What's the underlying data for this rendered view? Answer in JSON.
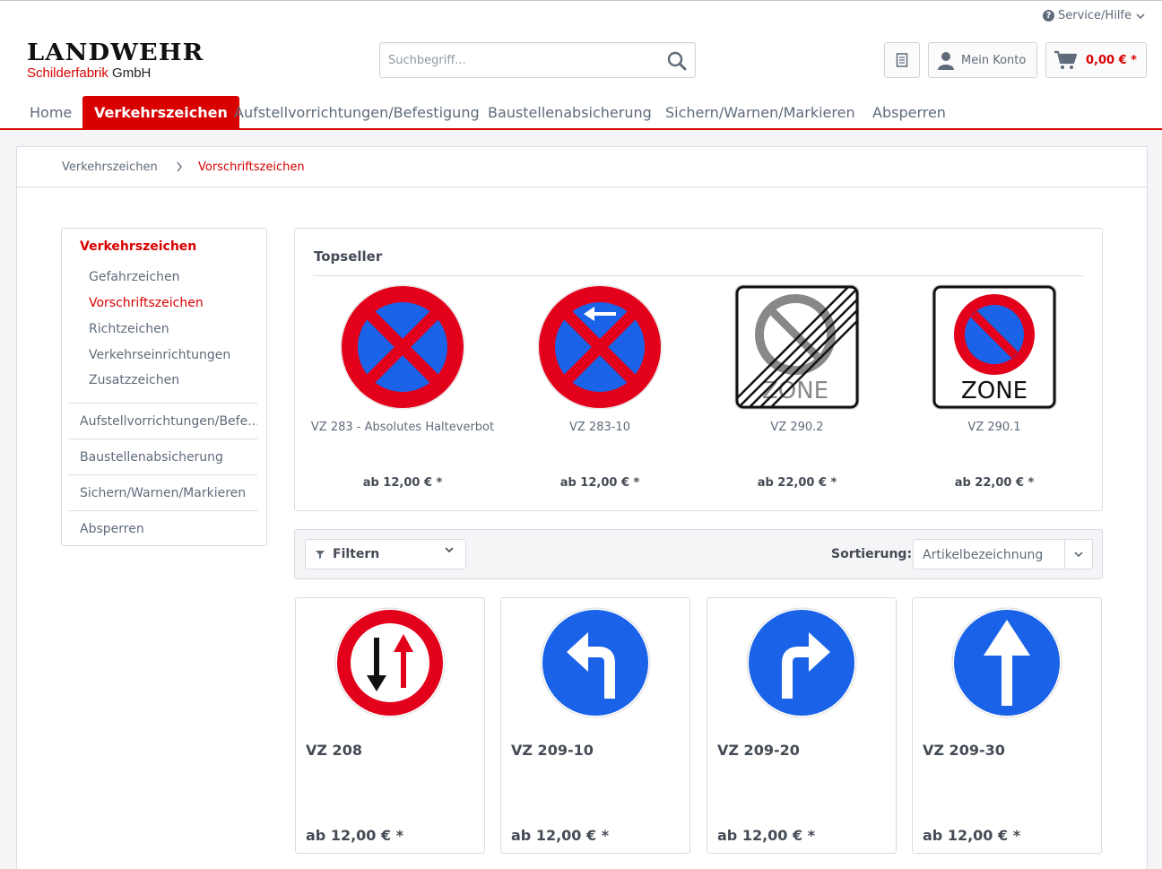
{
  "header": {
    "service_label": "Service/Hilfe",
    "logo_line1": "LANDWEHR",
    "logo_line2_red": "Schilderfabrik",
    "logo_line2_black": "GmbH",
    "search_placeholder": "Suchbegriff...",
    "account_label": "Mein Konto",
    "cart_amount": "0,00 € *"
  },
  "nav": [
    {
      "label": "Home"
    },
    {
      "label": "Verkehrszeichen"
    },
    {
      "label": "Aufstellvorrichtungen/Befestigung"
    },
    {
      "label": "Baustellenabsicherung"
    },
    {
      "label": "Sichern/Warnen/Markieren"
    },
    {
      "label": "Absperren"
    }
  ],
  "breadcrumb": [
    "Verkehrszeichen",
    "Vorschriftszeichen"
  ],
  "sidebar": {
    "heading": "Verkehrszeichen",
    "sub": [
      "Gefahrzeichen",
      "Vorschriftszeichen",
      "Richtzeichen",
      "Verkehrseinrichtungen",
      "Zusatzzeichen"
    ],
    "main": [
      "Aufstellvorrichtungen/Befe...",
      "Baustellenabsicherung",
      "Sichern/Warnen/Markieren",
      "Absperren"
    ]
  },
  "topseller": {
    "title": "Topseller",
    "items": [
      {
        "name": "VZ 283 - Absolutes Halteverbot",
        "price": "ab 12,00 € *",
        "icon": "halteverbot-sign-icon"
      },
      {
        "name": "VZ 283-10",
        "price": "ab 12,00 € *",
        "icon": "halteverbot-arrow-sign-icon"
      },
      {
        "name": "VZ 290.2",
        "price": "ab 22,00 € *",
        "icon": "zone-end-sign-icon"
      },
      {
        "name": "VZ 290.1",
        "price": "ab 22,00 € *",
        "icon": "zone-parking-sign-icon"
      }
    ],
    "zone_text": "ZONE"
  },
  "filterbar": {
    "filter_label": "Filtern",
    "sort_label": "Sortierung:",
    "sort_value": "Artikelbezeichnung"
  },
  "products": [
    {
      "name": "VZ 208",
      "price": "ab 12,00 € *",
      "icon": "vorrang-gegenverkehr-sign-icon"
    },
    {
      "name": "VZ 209-10",
      "price": "ab 12,00 € *",
      "icon": "links-abbiegen-sign-icon"
    },
    {
      "name": "VZ 209-20",
      "price": "ab 12,00 € *",
      "icon": "rechts-abbiegen-sign-icon"
    },
    {
      "name": "VZ 209-30",
      "price": "ab 12,00 € *",
      "icon": "geradeaus-sign-icon"
    }
  ],
  "colors": {
    "accent": "#d90000",
    "sign_blue": "#1a63e8",
    "sign_red": "#e3001b",
    "text": "#5f6b7a"
  }
}
